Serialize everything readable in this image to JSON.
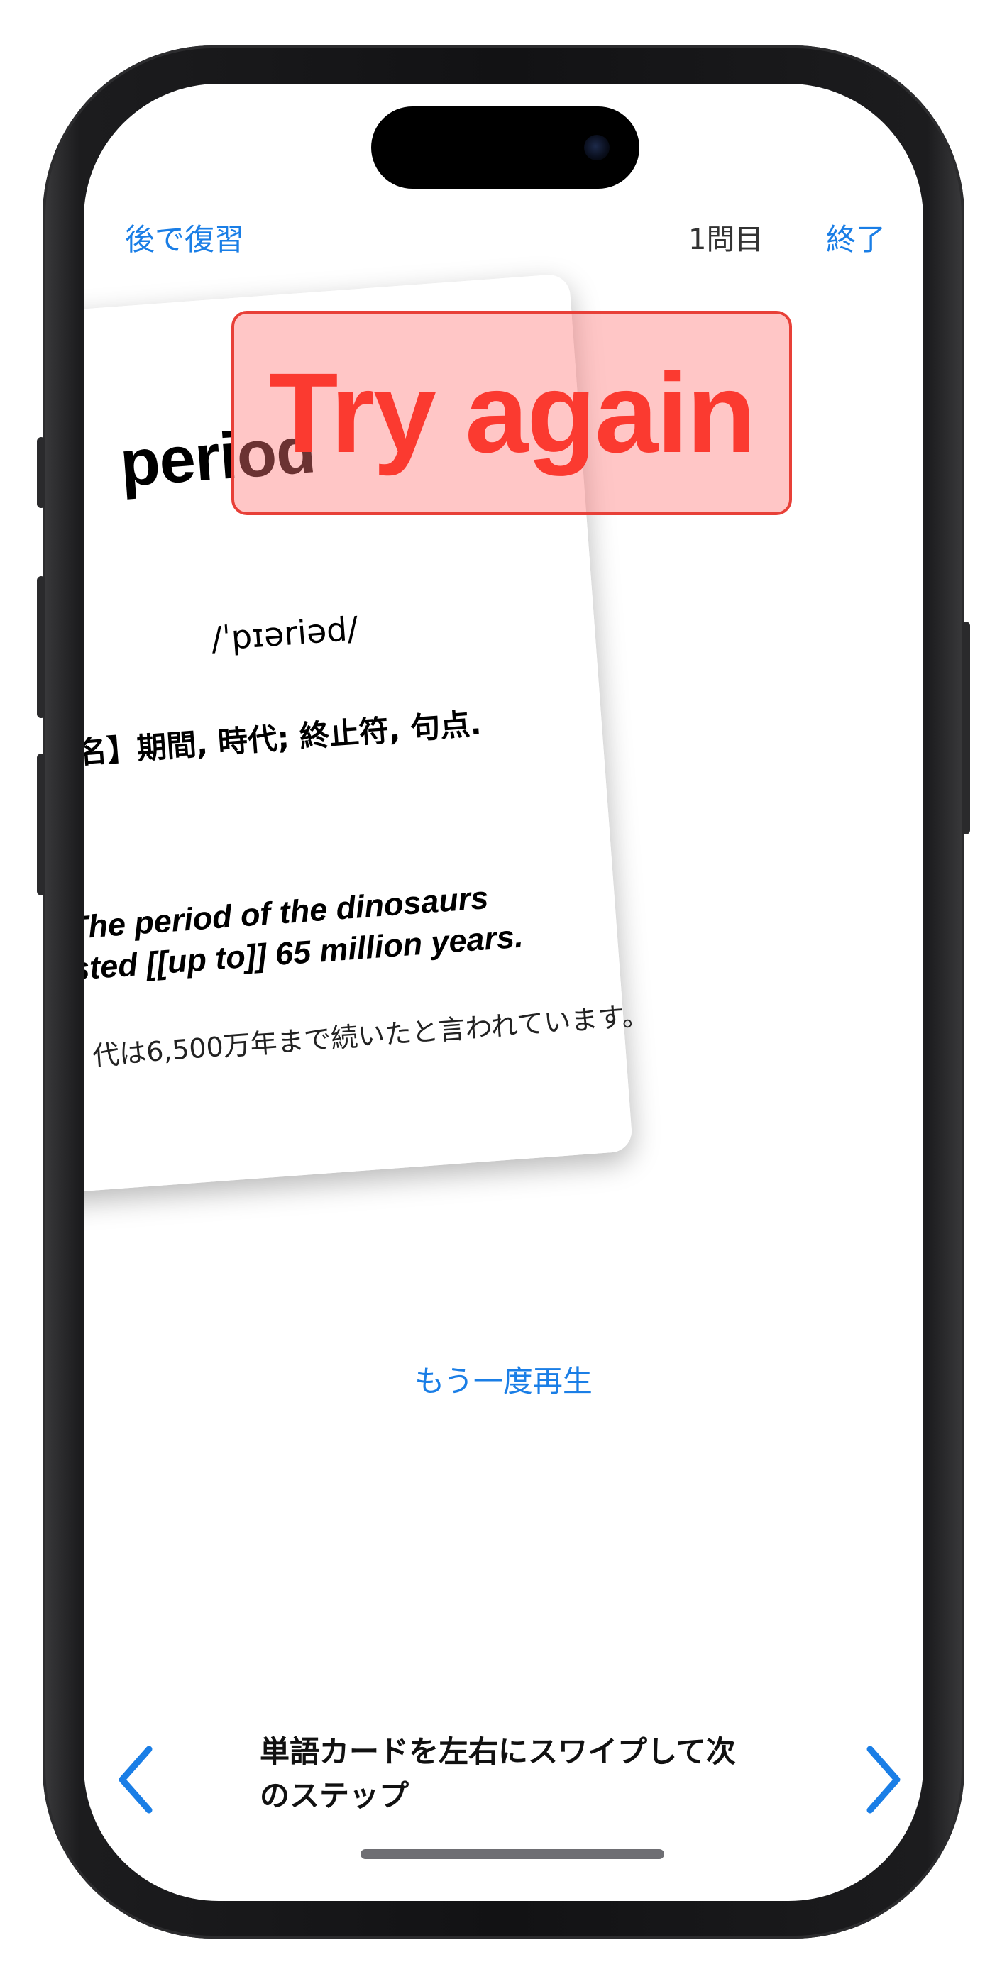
{
  "header": {
    "review_later": "後で復習",
    "question_counter": "1問目",
    "finish": "終了"
  },
  "card": {
    "word": "period",
    "pronunciation": "/ˈpɪəriəd/",
    "meaning": "名】期間, 時代; 終止符, 句点.",
    "example_line1": "The period of the dinosaurs",
    "example_line2": "sted [[up to]] 65 million years.",
    "translation": "代は6,500万年まで続いたと言われています。"
  },
  "feedback": {
    "label": "Try again",
    "color": "#fb3a30"
  },
  "replay_button": "もう一度再生",
  "footer": {
    "hint": "単語カードを左右にスワイプして次のステップ",
    "prev_icon": "chevron-left-icon",
    "next_icon": "chevron-right-icon"
  },
  "colors": {
    "accent": "#1a7ee6",
    "overlay_border": "#e84038"
  }
}
